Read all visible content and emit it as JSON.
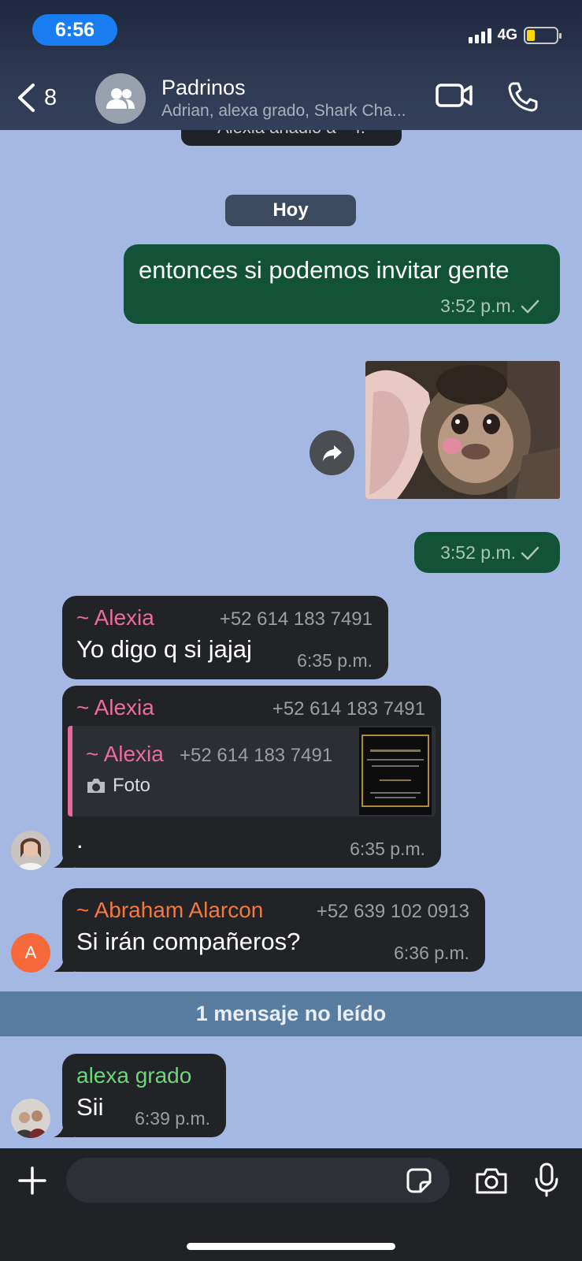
{
  "status_bar": {
    "time": "6:56",
    "network": "4G"
  },
  "header": {
    "back_count": "8",
    "title": "Padrinos",
    "subtitle": "Adrian, alexa grado, Shark Cha..."
  },
  "chat": {
    "cutoff_text": "Alexia añadió a ~ f.",
    "date_chip": "Hoy",
    "outgoing": [
      {
        "text": "entonces si podemos invitar gente",
        "time": "3:52 p.m."
      },
      {
        "text": "",
        "time": "3:52 p.m."
      }
    ],
    "incoming": [
      {
        "sender": "~ Alexia",
        "phone": "+52 614 183 7491",
        "text": "Yo digo q si jajaj",
        "time": "6:35 p.m."
      },
      {
        "sender": "~ Alexia",
        "phone": "+52 614 183 7491",
        "reply": {
          "sender": "~ Alexia",
          "phone": "+52 614 183 7491",
          "label": "Foto"
        },
        "text": ".",
        "time": "6:35 p.m."
      },
      {
        "sender": "~ Abraham Alarcon",
        "phone": "+52 639 102 0913",
        "text": "Si irán compañeros?",
        "time": "6:36 p.m.",
        "avatar_letter": "A"
      },
      {
        "sender": "alexa grado",
        "phone": "",
        "text": "Sii",
        "time": "6:39 p.m."
      }
    ],
    "unread_label": "1 mensaje no leído"
  },
  "input": {
    "placeholder": ""
  },
  "colors": {
    "chat_background": "#a5b8e4",
    "outgoing_bubble": "#125337",
    "incoming_bubble": "#212326",
    "sender_pink": "#ee6b9e",
    "sender_orange": "#f5793f",
    "sender_green": "#6cd67b",
    "unread_bar": "#587da0"
  },
  "icons": {
    "back": "chevron-left-icon",
    "group_avatar": "group-icon",
    "video": "video-camera-icon",
    "call": "phone-icon",
    "share": "share-icon",
    "plus": "plus-icon",
    "sticker": "sticker-icon",
    "camera": "camera-icon",
    "mic": "microphone-icon",
    "read_receipt": "check-icon"
  }
}
